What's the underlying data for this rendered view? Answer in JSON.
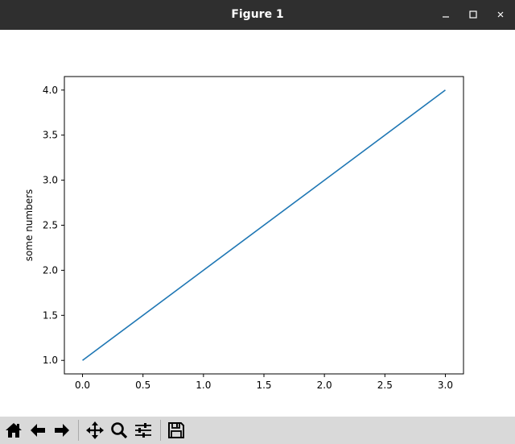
{
  "window": {
    "title": "Figure 1",
    "controls": [
      "minimize-icon",
      "maximize-icon",
      "close-icon"
    ]
  },
  "toolbar": {
    "buttons": [
      "home-icon",
      "back-icon",
      "forward-icon",
      "pan-icon",
      "zoom-icon",
      "configure-subplots-icon",
      "save-icon"
    ]
  },
  "chart_data": {
    "type": "line",
    "title": "",
    "xlabel": "",
    "ylabel": "some numbers",
    "xlim": [
      -0.15,
      3.15
    ],
    "ylim": [
      0.85,
      4.15
    ],
    "xticks": [
      "0.0",
      "0.5",
      "1.0",
      "1.5",
      "2.0",
      "2.5",
      "3.0"
    ],
    "yticks": [
      "1.0",
      "1.5",
      "2.0",
      "2.5",
      "3.0",
      "3.5",
      "4.0"
    ],
    "grid": false,
    "series": [
      {
        "x": [
          0,
          1,
          2,
          3
        ],
        "y": [
          1,
          2,
          3,
          4
        ],
        "color": "#1f77b4"
      }
    ]
  }
}
